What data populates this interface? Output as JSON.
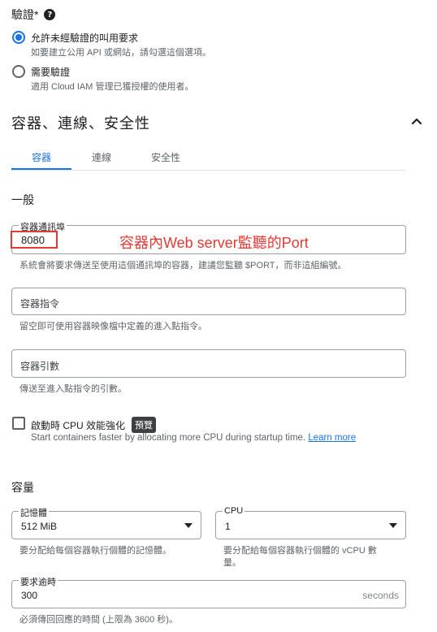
{
  "authentication": {
    "title": "驗證*",
    "options": [
      {
        "label": "允許未經驗證的叫用要求",
        "desc": "如要建立公用 API 或網站，請勾選這個選項。",
        "checked": true
      },
      {
        "label": "需要驗證",
        "desc": "適用 Cloud IAM 管理已獲授權的使用者。",
        "checked": false
      }
    ]
  },
  "section": {
    "title": "容器、連線、安全性",
    "tabs": [
      "容器",
      "連線",
      "安全性"
    ]
  },
  "general": {
    "heading": "一般",
    "port": {
      "label": "容器通訊埠",
      "value": "8080",
      "helper": "系統會將要求傳送至使用這個通訊埠的容器，建議您監聽 $PORT，而非這組編號。",
      "annotation": "容器內Web server監聽的Port"
    },
    "command": {
      "placeholder": "容器指令",
      "helper": "留空即可使用容器映像檔中定義的進入點指令。"
    },
    "args": {
      "placeholder": "容器引數",
      "helper": "傳送至進入點指令的引數。"
    },
    "cpu_boost": {
      "label": "啟動時 CPU 效能強化",
      "badge": "預覽",
      "desc": "Start containers faster by allocating more CPU during startup time.",
      "link": "Learn more"
    }
  },
  "capacity": {
    "heading": "容量",
    "memory": {
      "label": "記憶體",
      "value": "512 MiB",
      "helper": "要分配給每個容器執行個體的記憶體。"
    },
    "cpu": {
      "label": "CPU",
      "value": "1",
      "helper_line1": "要分配給每個容器執行個體的 vCPU 數",
      "helper_line2": "量。"
    },
    "timeout": {
      "label": "要求逾時",
      "value": "300",
      "suffix": "seconds",
      "helper": "必須傳回回應的時間 (上限為 3600 秒)。"
    }
  }
}
